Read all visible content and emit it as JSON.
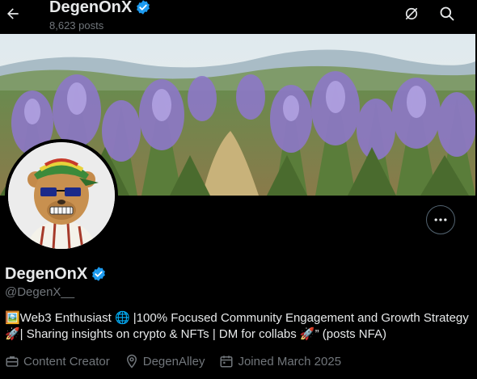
{
  "header": {
    "title": "DegenOnX",
    "posts_count": "8,623 posts"
  },
  "profile": {
    "name": "DegenOnX",
    "handle": "@DegenX__",
    "bio": "🖼️Web3 Enthusiast 🌐 |100% Focused Community Engagement and Growth Strategy 🚀| Sharing insights on crypto & NFTs | DM for collabs 🚀” (posts NFA)",
    "meta": {
      "category": "Content Creator",
      "location": "DegenAlley",
      "joined": "Joined March 2025"
    }
  },
  "colors": {
    "background": "#000000",
    "text": "#e7e9ea",
    "muted": "#71767b",
    "verified": "#1d9bf0"
  },
  "icons": [
    "back-arrow-icon",
    "verified-icon",
    "notifications-off-icon",
    "search-icon",
    "more-icon",
    "briefcase-icon",
    "location-pin-icon",
    "calendar-icon"
  ]
}
